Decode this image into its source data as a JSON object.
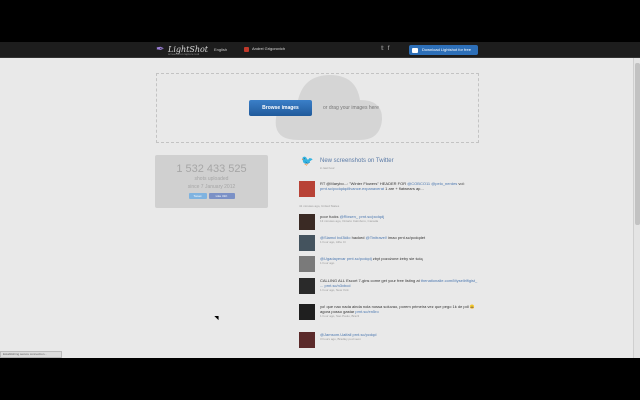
{
  "header": {
    "logo_text": "LightShot",
    "logo_sub": "screenshot capture tool",
    "language": "English",
    "user_name": "Andrei Grigorovich",
    "download_label": "Download Lightshot for free"
  },
  "upload": {
    "browse_label": "Browse images",
    "drag_text": "or drag your images here"
  },
  "stats": {
    "count": "1 532 433 525",
    "label": "shots uploaded",
    "since": "since 7 January 2012",
    "tweet_label": "Tweet",
    "like_label": "Like 31K"
  },
  "twitter": {
    "title": "New screenshots on Twitter",
    "subtitle": "in last hour"
  },
  "tweets": [
    {
      "text_a": "RT @Marybo...: \"Winter Flowers\" HEADER FOR ",
      "link_a": "@COBCO11 @pelo_nerdes",
      "text_b": " vol: ",
      "link_b": "prnt.sc/pcdqdq#ilvance.expanaverat",
      "text_c": " 1 are + flatwears ap...",
      "meta": "41 minutes ago, United States"
    },
    {
      "text_a": "poor fucks ",
      "link_a": "@Rixsen_",
      "text_b": " ",
      "link_b": "prnt.sc/pcdqdj",
      "text_c": "",
      "meta": "13 minutes ago, Ontario Calmboro, Canada"
    },
    {
      "text_a": "",
      "link_a": "@Siamcl bcl3kllo",
      "text_b": " hacked ",
      "link_b": "@Tinitravel!",
      "text_c": " imao prnt.sc/pcdqdet",
      "meta": "1 hour ago, Athe Cr"
    },
    {
      "text_a": "",
      "link_a": "@Ugadayevar prnt.sc/pcdqdj",
      "text_b": " zbyt pozożone żeby sie ścią",
      "link_b": "",
      "text_c": "",
      "meta": "1 hour ago"
    },
    {
      "text_a": "CALLING ALL Escort 7-gins come get your free listing at ",
      "link_a": "thenationalie.com/Mysellrlfigist_ ...",
      "text_b": " ",
      "link_b": "prnt.sc/n3xbcd",
      "text_c": "",
      "meta": "1 hour ago, New York"
    },
    {
      "text_a": "yo! que nao nada ainda nola nossa soluvao, porem primeira vez que pego 1k de pdl 😀 agora posso gastar ",
      "link_a": "prnt.sc/en5ro",
      "text_b": "",
      "link_b": "",
      "text_c": "",
      "meta": "1 hour ago, Sao Paulo, Brazil"
    },
    {
      "text_a": "",
      "link_a": "@Jamsom.Uaifall prnt.sc/pcdqd",
      "text_b": "",
      "link_b": "",
      "text_c": "",
      "meta": "3 hours ago, Bradley pod xeon"
    }
  ],
  "status_text": "Establishing secure connection..."
}
